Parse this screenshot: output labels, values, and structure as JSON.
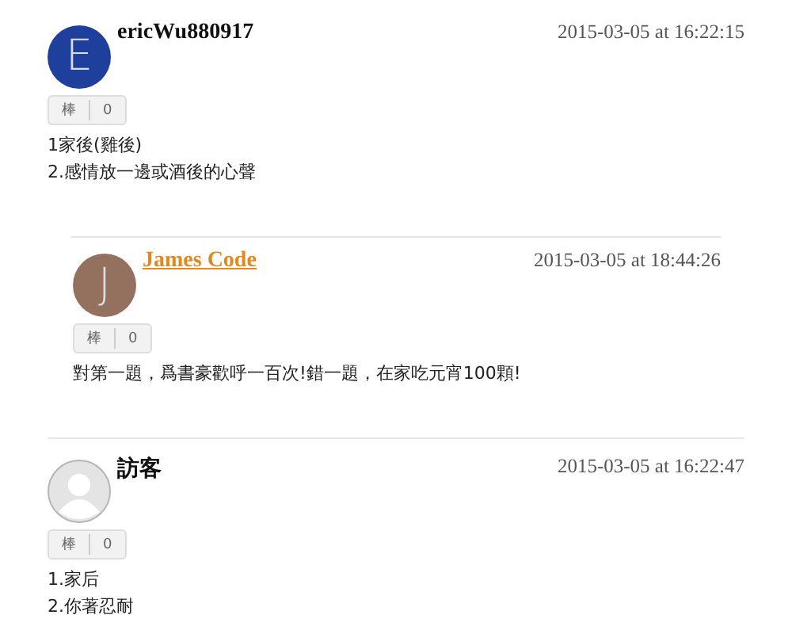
{
  "comments": [
    {
      "avatar": {
        "kind": "letter",
        "letter": "E",
        "color": "#1f3f9c"
      },
      "name": "ericWu880917",
      "link": false,
      "date": "2015-03-05 at 16:22:15",
      "like": {
        "label": "棒",
        "count": "0"
      },
      "lines": [
        "1家後(雞後)",
        "2.感情放一邊或酒後的心聲"
      ],
      "children": [
        {
          "avatar": {
            "kind": "letter",
            "letter": "J",
            "color": "#94705f"
          },
          "name": "James Code",
          "link": true,
          "date": "2015-03-05 at 18:44:26",
          "like": {
            "label": "棒",
            "count": "0"
          },
          "lines": [
            "對第一題，爲書豪歡呼一百次!錯一題，在家吃元宵100顆!"
          ]
        }
      ]
    },
    {
      "avatar": {
        "kind": "guest"
      },
      "name": "訪客",
      "link": false,
      "date": "2015-03-05 at 16:22:47",
      "like": {
        "label": "棒",
        "count": "0"
      },
      "lines": [
        "1.家后",
        "2.你著忍耐"
      ]
    }
  ]
}
